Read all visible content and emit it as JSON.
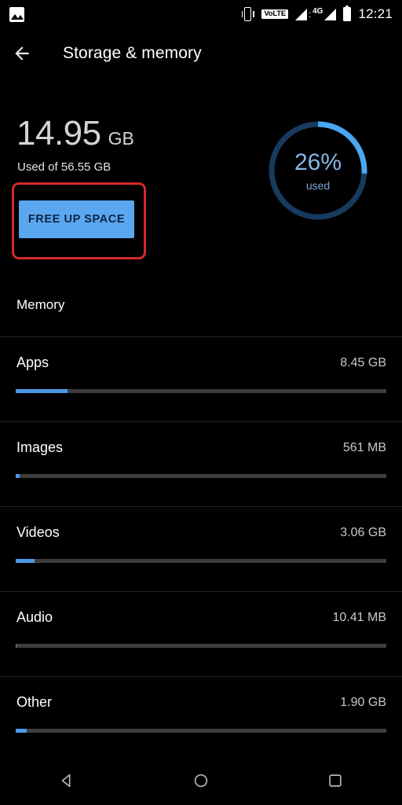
{
  "status_bar": {
    "notification_icon": "image-screenshot-icon",
    "vibrate_icon": "vibrate-icon",
    "volte_label": "VoLTE",
    "signal_icon": "signal-bars-icon",
    "sim_separator": ":",
    "network_type": "4G",
    "battery_icon": "battery-full-icon",
    "clock": "12:21"
  },
  "app_bar": {
    "back_icon": "back-arrow-icon",
    "title": "Storage & memory"
  },
  "summary": {
    "used_number": "14.95",
    "used_unit": "GB",
    "used_of": "Used of 56.55 GB",
    "free_up_label": "FREE UP SPACE",
    "ring": {
      "percent_label": "26%",
      "used_label": "used",
      "percent_value": 26,
      "arc_color": "#4aa6f0",
      "track_color": "#173b5e"
    },
    "highlight_color": "#d42a2a",
    "button_color": "#5aa7f0"
  },
  "memory": {
    "section_title": "Memory",
    "rows": [
      {
        "label": "Apps",
        "value": "8.45 GB",
        "fill_percent": 14
      },
      {
        "label": "Images",
        "value": "561 MB",
        "fill_percent": 1
      },
      {
        "label": "Videos",
        "value": "3.06 GB",
        "fill_percent": 5
      },
      {
        "label": "Audio",
        "value": "10.41 MB",
        "fill_percent": 0.3
      },
      {
        "label": "Other",
        "value": "1.90 GB",
        "fill_percent": 3
      }
    ]
  },
  "nav_bar": {
    "back_label": "back-triangle-icon",
    "home_label": "home-circle-icon",
    "recents_label": "recents-square-icon"
  }
}
